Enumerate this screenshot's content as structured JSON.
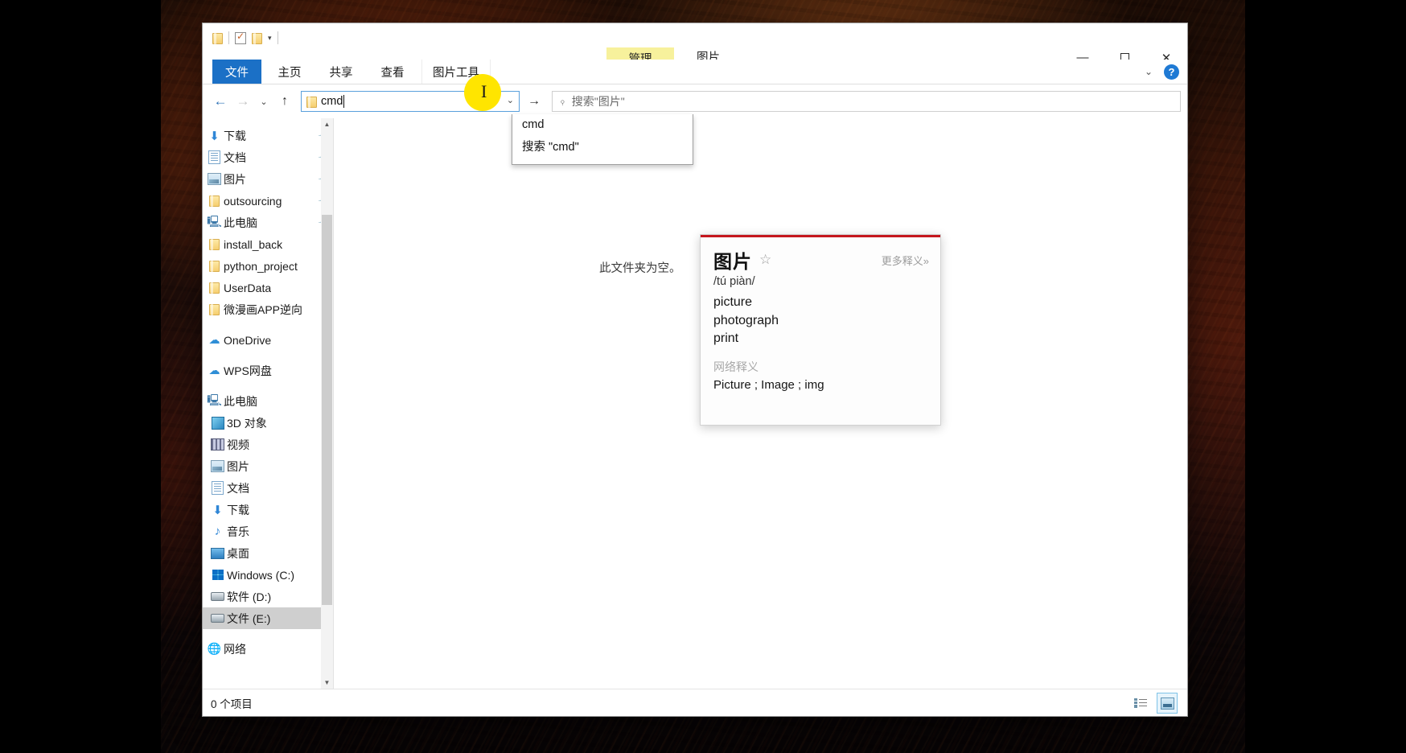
{
  "window": {
    "title": "图片",
    "context_tab_header": "管理",
    "controls": {
      "minimize": "—",
      "maximize": "▭",
      "close": "✕",
      "ribbon_collapse": "⌄",
      "help": "?"
    }
  },
  "quick_access": {
    "items": [
      {
        "name": "folder-icon",
        "glyph": ""
      },
      {
        "name": "properties-icon",
        "glyph": ""
      },
      {
        "name": "new-folder-icon",
        "glyph": ""
      },
      {
        "name": "customize-caret",
        "glyph": "▾"
      }
    ]
  },
  "ribbon": {
    "tabs": [
      {
        "id": "file",
        "label": "文件",
        "selected": true
      },
      {
        "id": "home",
        "label": "主页",
        "selected": false
      },
      {
        "id": "share",
        "label": "共享",
        "selected": false
      },
      {
        "id": "view",
        "label": "查看",
        "selected": false
      },
      {
        "id": "picture-tools",
        "label": "图片工具",
        "selected": false,
        "contextual": true
      }
    ]
  },
  "navbar": {
    "back": "←",
    "forward": "→",
    "recent": "⌄",
    "up": "↑",
    "go": "→",
    "address_value": "cmd",
    "address_chevron": "⌄"
  },
  "search": {
    "placeholder": "搜索\"图片\"",
    "icon": "search-icon"
  },
  "autocomplete": {
    "items": [
      {
        "label": "cmd"
      },
      {
        "label": "搜索 \"cmd\""
      }
    ]
  },
  "nav_pane": {
    "groups": [
      {
        "items": [
          {
            "label": "下载",
            "icon": "download-icon",
            "pinned": true,
            "level": 1
          },
          {
            "label": "文档",
            "icon": "document-icon",
            "pinned": true,
            "level": 1
          },
          {
            "label": "图片",
            "icon": "pictures-icon",
            "pinned": true,
            "level": 1
          },
          {
            "label": "outsourcing",
            "icon": "folder-icon",
            "pinned": true,
            "level": 1
          },
          {
            "label": "此电脑",
            "icon": "this-pc-icon",
            "pinned": true,
            "level": 1
          },
          {
            "label": "install_back",
            "icon": "folder-icon",
            "pinned": false,
            "level": 1
          },
          {
            "label": "python_project",
            "icon": "folder-icon",
            "pinned": false,
            "level": 1
          },
          {
            "label": "UserData",
            "icon": "folder-icon",
            "pinned": false,
            "level": 1
          },
          {
            "label": "微漫画APP逆向",
            "icon": "folder-icon",
            "pinned": false,
            "level": 1
          }
        ]
      },
      {
        "items": [
          {
            "label": "OneDrive",
            "icon": "cloud-icon",
            "pinned": false,
            "level": 1
          }
        ]
      },
      {
        "items": [
          {
            "label": "WPS网盘",
            "icon": "cloud-icon",
            "pinned": false,
            "level": 1
          }
        ]
      },
      {
        "items": [
          {
            "label": "此电脑",
            "icon": "this-pc-icon",
            "pinned": false,
            "level": 1
          },
          {
            "label": "3D 对象",
            "icon": "3d-objects-icon",
            "pinned": false,
            "level": 2
          },
          {
            "label": "视频",
            "icon": "videos-icon",
            "pinned": false,
            "level": 2
          },
          {
            "label": "图片",
            "icon": "pictures-icon",
            "pinned": false,
            "level": 2
          },
          {
            "label": "文档",
            "icon": "document-icon",
            "pinned": false,
            "level": 2
          },
          {
            "label": "下载",
            "icon": "download-icon",
            "pinned": false,
            "level": 2
          },
          {
            "label": "音乐",
            "icon": "music-icon",
            "pinned": false,
            "level": 2
          },
          {
            "label": "桌面",
            "icon": "desktop-icon",
            "pinned": false,
            "level": 2
          },
          {
            "label": "Windows (C:)",
            "icon": "windows-drive-icon",
            "pinned": false,
            "level": 2
          },
          {
            "label": "软件 (D:)",
            "icon": "drive-icon",
            "pinned": false,
            "level": 2
          },
          {
            "label": "文件 (E:)",
            "icon": "drive-icon",
            "pinned": false,
            "level": 2,
            "selected": true
          }
        ]
      },
      {
        "items": [
          {
            "label": "网络",
            "icon": "network-icon",
            "pinned": false,
            "level": 1
          }
        ]
      }
    ],
    "scrollbar": {
      "up": "▲",
      "down": "▼"
    }
  },
  "content": {
    "empty_message": "此文件夹为空。"
  },
  "dictionary_popup": {
    "word": "图片",
    "star": "☆",
    "more_link": "更多释义»",
    "pronunciation": "/tú piàn/",
    "definitions": [
      "picture",
      "photograph",
      "print"
    ],
    "web_section_title": "网络释义",
    "web_definition": "Picture ; Image ; img"
  },
  "status_bar": {
    "item_count": "0 个项目",
    "views": [
      {
        "name": "details-view",
        "active": false
      },
      {
        "name": "large-icons-view",
        "active": true
      }
    ]
  }
}
